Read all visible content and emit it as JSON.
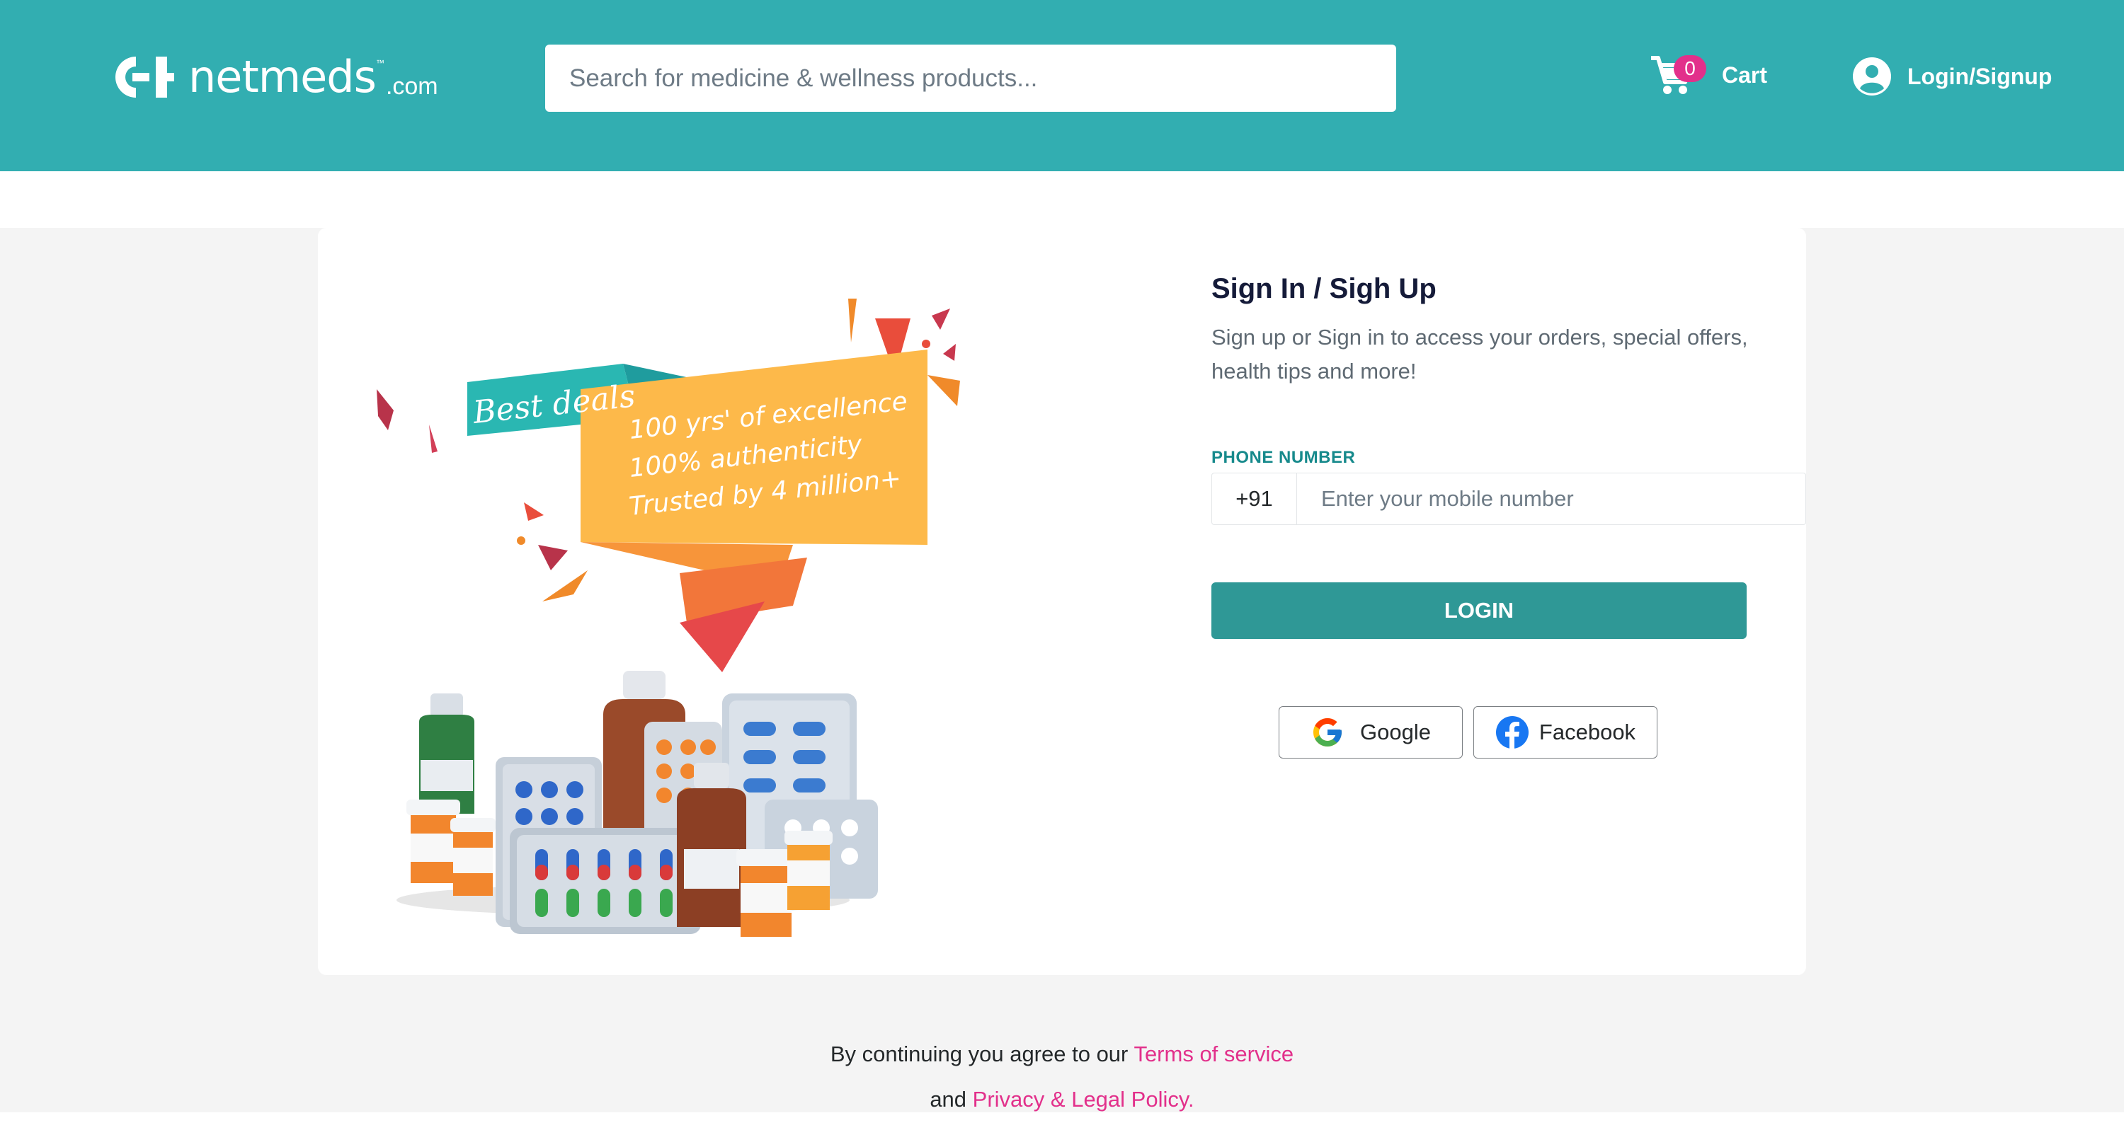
{
  "header": {
    "logo": {
      "brand": "netmeds",
      "suffix": ".com",
      "tm": "™"
    },
    "search": {
      "placeholder": "Search for medicine & wellness products..."
    },
    "cart": {
      "label": "Cart",
      "count": "0"
    },
    "account": {
      "label": "Login/Signup"
    }
  },
  "promo": {
    "badge": "Best deals",
    "lines": [
      "100 yrs' of excellence",
      "100% authenticity",
      "Trusted by 4 million+"
    ]
  },
  "signin": {
    "title": "Sign In / Sigh Up",
    "subtitle": "Sign up or Sign in to access your orders, special offers, health tips and more!",
    "phone_label": "PHONE NUMBER",
    "country_code": "+91",
    "phone_placeholder": "Enter your mobile number",
    "login_label": "LOGIN",
    "google_label": "Google",
    "facebook_label": "Facebook"
  },
  "terms": {
    "prefix": "By continuing you agree to our",
    "terms_link": "Terms of service",
    "and": "and",
    "privacy_link": "Privacy & Legal Policy."
  },
  "colors": {
    "header_bg": "#32aeb1",
    "login_button": "#2f9896",
    "link_pink": "#e2308b",
    "label_teal": "#178a8c"
  },
  "icons": [
    "netmeds-logo-icon",
    "cart-icon",
    "user-circle-icon",
    "google-icon",
    "facebook-icon"
  ]
}
